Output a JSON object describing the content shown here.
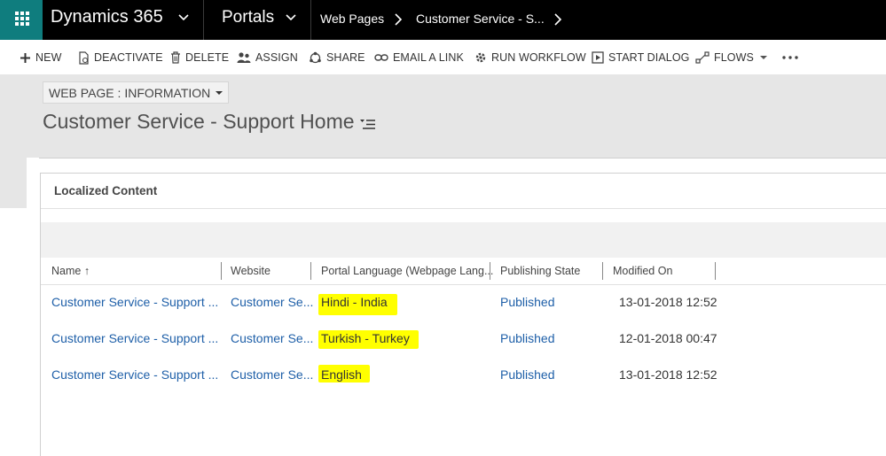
{
  "topbar": {
    "app_title": "Dynamics 365",
    "area": "Portals",
    "breadcrumb": [
      "Web Pages",
      "Customer Service - S..."
    ]
  },
  "commands": [
    {
      "label": "NEW",
      "icon": "plus-icon"
    },
    {
      "label": "DEACTIVATE",
      "icon": "deactivate-icon"
    },
    {
      "label": "DELETE",
      "icon": "trash-icon"
    },
    {
      "label": "ASSIGN",
      "icon": "assign-icon"
    },
    {
      "label": "SHARE",
      "icon": "share-icon"
    },
    {
      "label": "EMAIL A LINK",
      "icon": "link-icon"
    },
    {
      "label": "RUN WORKFLOW",
      "icon": "workflow-icon"
    },
    {
      "label": "START DIALOG",
      "icon": "dialog-icon"
    },
    {
      "label": "FLOWS",
      "icon": "flow-icon"
    }
  ],
  "header": {
    "form_selector": "WEB PAGE : INFORMATION",
    "record_title": "Customer Service - Support Home"
  },
  "section": {
    "title": "Localized Content"
  },
  "grid": {
    "columns": [
      "Name ↑",
      "Website",
      "Portal Language (Webpage Lang...",
      "Publishing State",
      "Modified On"
    ],
    "rows": [
      {
        "name": "Customer Service - Support ...",
        "website": "Customer Se...",
        "language": "Hindi - India",
        "state": "Published",
        "modified": "13-01-2018 12:52"
      },
      {
        "name": "Customer Service - Support ...",
        "website": "Customer Se...",
        "language": "Turkish - Turkey",
        "state": "Published",
        "modified": "12-01-2018 00:47"
      },
      {
        "name": "Customer Service - Support ...",
        "website": "Customer Se...",
        "language": "English",
        "state": "Published",
        "modified": "13-01-2018 12:52"
      }
    ],
    "highlight_color": "#ffff00"
  }
}
